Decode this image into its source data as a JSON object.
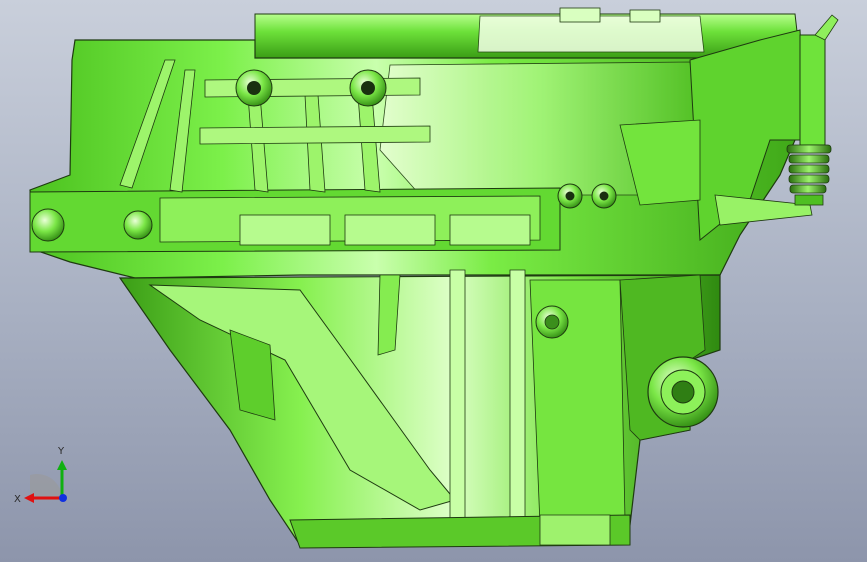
{
  "colors": {
    "background_top": "#c9cfdb",
    "background_bottom": "#8d95ab",
    "part_base": "#6ee63a",
    "part_highlight": "#d8ffc0",
    "part_shadow": "#2f8f12",
    "edge": "#1e3a10",
    "axis_x": "#e01010",
    "axis_y": "#10b010",
    "axis_z": "#1030e0"
  },
  "triad": {
    "x_label": "X",
    "y_label": "Y"
  },
  "model": {
    "icon": "gearbox-housing-3d-model"
  }
}
